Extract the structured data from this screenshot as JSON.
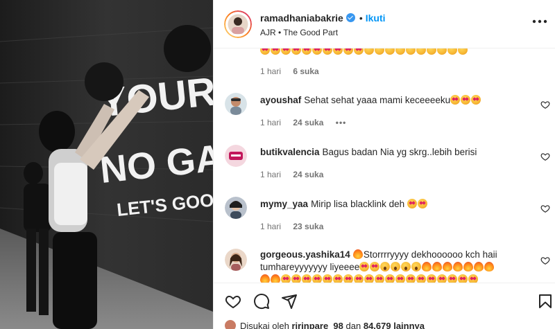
{
  "post": {
    "username": "ramadhaniabakrie",
    "separator": "•",
    "follow_label": "Ikuti",
    "audio": "AJR • The Good Part",
    "media_text": {
      "line1": "YOUR",
      "line2": "NO GAIN",
      "line3": "LET'S GOOOOOOO"
    }
  },
  "comments": [
    {
      "username": "",
      "text": "",
      "time": "1 hari",
      "likes": "6 suka",
      "emoji_count": 20,
      "has_dots": false,
      "has_heart": false
    },
    {
      "username": "ayoushaf",
      "text": "Sehat sehat yaaa mami keceeeeku",
      "time": "1 hari",
      "likes": "24 suka",
      "has_dots": true,
      "has_heart": true
    },
    {
      "username": "butikvalencia",
      "text": "Bagus badan Nia yg skrg..lebih berisi",
      "time": "1 hari",
      "likes": "24 suka",
      "has_dots": false,
      "has_heart": true
    },
    {
      "username": "mymy_yaa",
      "text": "Mirip lisa blacklink deh",
      "time": "1 hari",
      "likes": "23 suka",
      "has_dots": false,
      "has_heart": true
    },
    {
      "username": "gorgeous.yashika14",
      "text": "Storrrryyyy dekhoooooo kch haii tumhareyyyyyyy liyeeee",
      "time": "",
      "likes": "",
      "has_dots": false,
      "has_heart": true
    }
  ],
  "liked_by": {
    "prefix": "Disukai oleh",
    "user": "ririnpare_98",
    "middle": "dan",
    "count": "84.679 lainnya"
  },
  "icons": [
    "heart-icon",
    "comment-icon",
    "share-icon",
    "bookmark-icon",
    "more-icon",
    "verified-icon"
  ],
  "colors": {
    "accent": "#0095f6",
    "verified": "#3897f0",
    "text": "#262626",
    "muted": "#737373",
    "border": "#efefef"
  }
}
